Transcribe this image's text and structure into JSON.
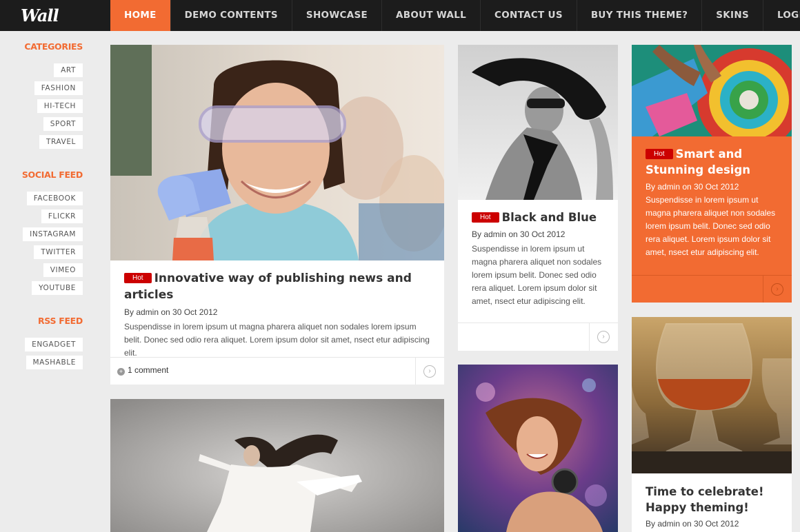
{
  "brand": {
    "logo": "Wall"
  },
  "nav": [
    {
      "label": "HOME",
      "active": true
    },
    {
      "label": "DEMO CONTENTS"
    },
    {
      "label": "SHOWCASE"
    },
    {
      "label": "ABOUT WALL"
    },
    {
      "label": "CONTACT US"
    },
    {
      "label": "BUY THIS THEME?"
    },
    {
      "label": "SKINS"
    },
    {
      "label": "LOGIN"
    }
  ],
  "sidebar": {
    "categories_heading": "CATEGORIES",
    "categories": [
      "ART",
      "FASHION",
      "HI-TECH",
      "SPORT",
      "TRAVEL"
    ],
    "social_heading": "SOCIAL FEED",
    "social": [
      "FACEBOOK",
      "FLICKR",
      "INSTAGRAM",
      "TWITTER",
      "VIMEO",
      "YOUTUBE"
    ],
    "rss_heading": "RSS FEED",
    "rss": [
      "ENGADGET",
      "MASHABLE"
    ]
  },
  "posts": [
    {
      "badge": "Hot",
      "title": "Innovative way of publishing news and articles",
      "meta": "By admin on 30 Oct 2012",
      "excerpt": "Suspendisse in lorem ipsum ut magna pharera aliquet non sodales lorem ipsum belit. Donec sed odio rera aliquet. Lorem ipsum dolor sit amet, nsect etur adipiscing elit.",
      "comments": "1 comment"
    },
    {
      "badge": "Hot",
      "title": "Black and Blue",
      "meta": "By admin on 30 Oct 2012",
      "excerpt": "Suspendisse in lorem ipsum ut magna pharera aliquet non sodales lorem ipsum belit. Donec sed odio rera aliquet. Lorem ipsum dolor sit amet, nsect etur adipiscing elit."
    },
    {
      "badge": "Hot",
      "title": "Smart and Stunning design",
      "meta": "By admin on 30 Oct 2012",
      "excerpt": "Suspendisse in lorem ipsum ut magna pharera aliquet non sodales lorem ipsum belit. Donec sed odio rera aliquet. Lorem ipsum dolor sit amet, nsect etur adipiscing elit."
    },
    {
      "title": "Time to celebrate! Happy theming!",
      "meta": "By admin on 30 Oct 2012"
    }
  ],
  "colors": {
    "accent": "#f26b32",
    "hot": "#cc0000",
    "topbar": "#1c1c1c",
    "page": "#ececec"
  }
}
